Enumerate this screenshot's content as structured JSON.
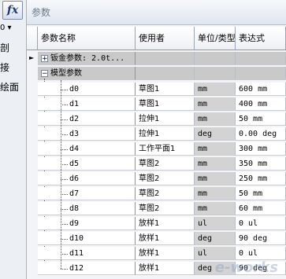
{
  "left_panel": {
    "fx_label": "fx",
    "dropdown_glyph": "0 ▾",
    "items": [
      "剖",
      "接",
      "绘面"
    ]
  },
  "dialog": {
    "title": "参数"
  },
  "columns": {
    "name": "参数名称",
    "used_by": "使用者",
    "unit": "单位/类型",
    "expression": "表达式"
  },
  "groups": [
    {
      "label": "钣金参数: 2.0t...",
      "toggle": "+"
    },
    {
      "label": "模型参数",
      "toggle": "−"
    }
  ],
  "rows": [
    {
      "name": "d0",
      "used_by": "草图1",
      "unit": "mm",
      "expression": "600 mm"
    },
    {
      "name": "d1",
      "used_by": "草图1",
      "unit": "mm",
      "expression": "400 mm"
    },
    {
      "name": "d2",
      "used_by": "拉伸1",
      "unit": "mm",
      "expression": "50 mm"
    },
    {
      "name": "d3",
      "used_by": "拉伸1",
      "unit": "deg",
      "expression": "0.00 deg"
    },
    {
      "name": "d4",
      "used_by": "工作平面1",
      "unit": "mm",
      "expression": "300 mm"
    },
    {
      "name": "d5",
      "used_by": "草图2",
      "unit": "mm",
      "expression": "350 mm"
    },
    {
      "name": "d6",
      "used_by": "草图2",
      "unit": "mm",
      "expression": "250 mm"
    },
    {
      "name": "d7",
      "used_by": "草图2",
      "unit": "mm",
      "expression": "50 mm"
    },
    {
      "name": "d8",
      "used_by": "草图2",
      "unit": "mm",
      "expression": "60 mm"
    },
    {
      "name": "d9",
      "used_by": "放样1",
      "unit": "ul",
      "expression": "0 ul"
    },
    {
      "name": "d10",
      "used_by": "放样1",
      "unit": "deg",
      "expression": "90 deg"
    },
    {
      "name": "d11",
      "used_by": "放样1",
      "unit": "ul",
      "expression": "0 ul"
    },
    {
      "name": "d12",
      "used_by": "放样1",
      "unit": "deg",
      "expression": "90 deg"
    }
  ],
  "watermark": "e-works"
}
